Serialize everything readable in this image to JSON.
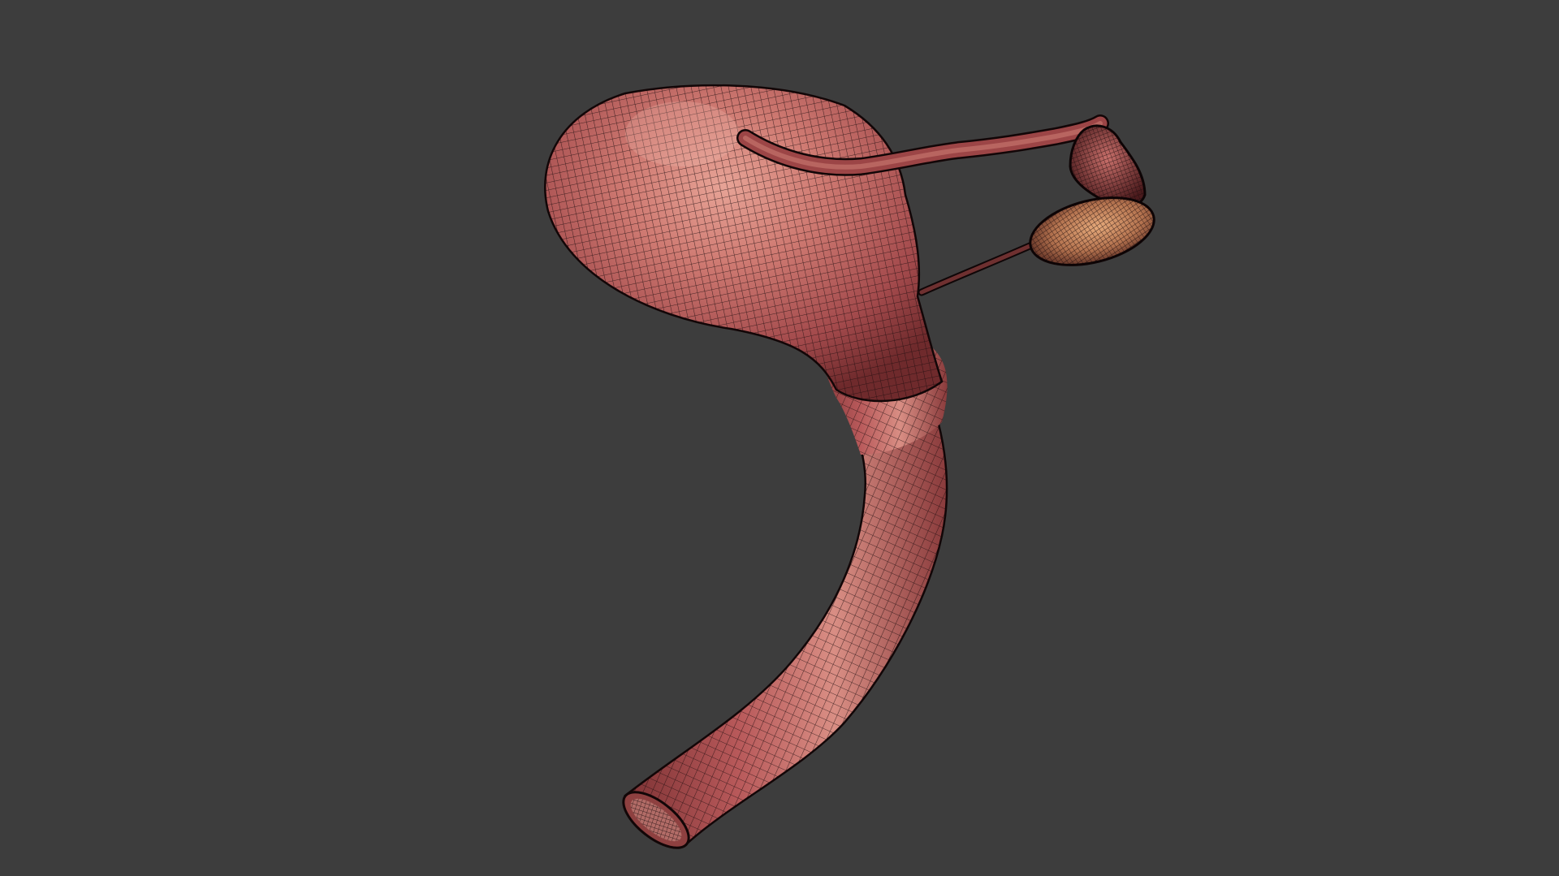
{
  "viewport": {
    "background_color": "#3d3d3d",
    "display_mode": "wireframe-on-shaded"
  },
  "model": {
    "subject": "uterus-with-fallopian-tube-and-ovary",
    "base_color": "#b8595a",
    "highlight_color": "#e7a396",
    "shadow_color": "#6f2a2c",
    "wire_color": "#1d0d0e",
    "ovary_color": "#c88a5e",
    "components": [
      "uterus-fundus",
      "uterus-body",
      "cervix-vaginal-canal",
      "fallopian-tube",
      "ovarian-ligament",
      "ovary",
      "fimbriae"
    ]
  }
}
